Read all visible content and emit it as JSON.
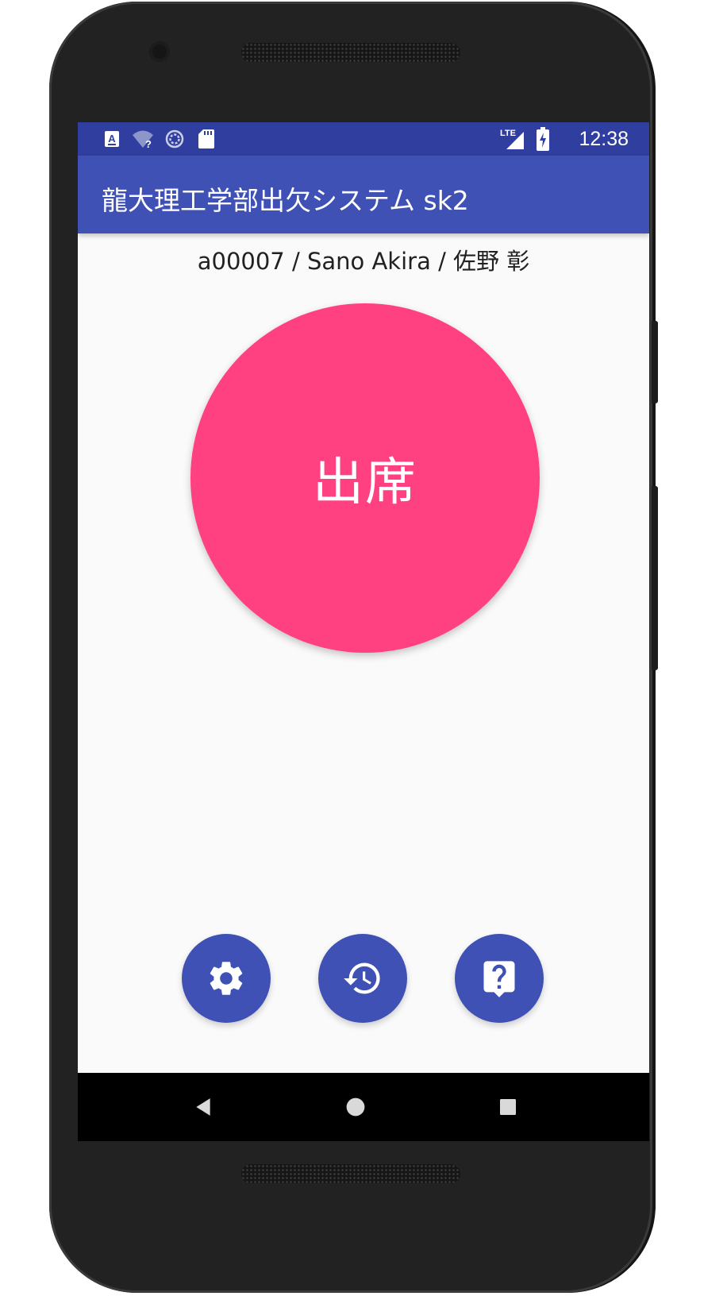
{
  "status_bar": {
    "time": "12:38",
    "network_label": "LTE",
    "notification_icons": [
      "text-notification-icon",
      "wifi-unknown-icon",
      "sync-icon",
      "sd-card-icon"
    ],
    "system_icons": [
      "lte-signal-icon",
      "battery-charging-icon"
    ]
  },
  "app_bar": {
    "title": "龍大理工学部出欠システム sk2"
  },
  "user": {
    "display": "a00007 / Sano Akira / 佐野 彰"
  },
  "attend_button": {
    "label": "出席"
  },
  "actions": [
    {
      "name": "settings",
      "icon": "gear-icon"
    },
    {
      "name": "history",
      "icon": "history-icon"
    },
    {
      "name": "help",
      "icon": "help-icon"
    }
  ],
  "navigation": {
    "buttons": [
      "back-icon",
      "home-icon",
      "recents-icon"
    ]
  },
  "colors": {
    "status_bar": "#303f9f",
    "primary": "#3f51b5",
    "accent": "#ff4081",
    "background": "#fafafa"
  }
}
